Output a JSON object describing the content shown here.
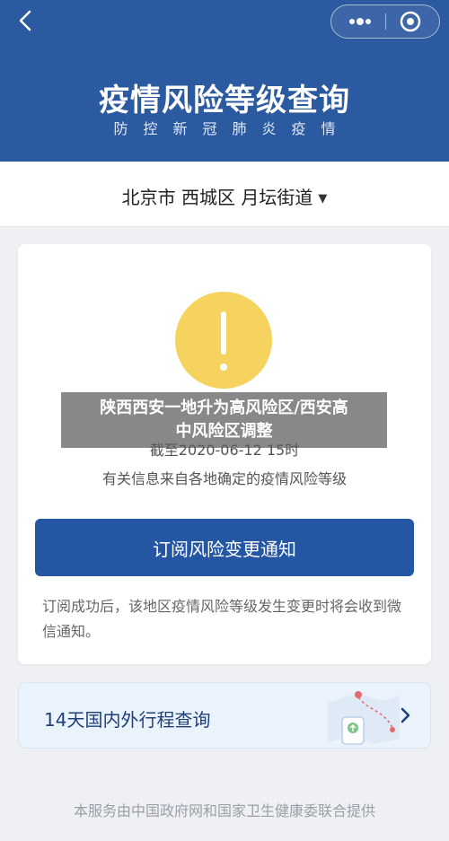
{
  "header": {
    "title": "疫情风险等级查询",
    "subtitle": "防控新冠肺炎疫情"
  },
  "location": {
    "text": "北京市 西城区 月坛街道"
  },
  "risk_card": {
    "as_of": "截至2020-06-12 15时",
    "source_note": "有关信息来自各地确定的疫情风险等级",
    "subscribe_button": "订阅风险变更通知",
    "subscribe_desc": "订阅成功后，该地区疫情风险等级发生变更时将会收到微信通知。",
    "warning_color": "#f6d35f"
  },
  "trip_query": {
    "label": "14天国内外行程查询"
  },
  "footer": {
    "text": "本服务由中国政府网和国家卫生健康委联合提供"
  },
  "overlay": {
    "line1": "陕西西安一地升为高风险区/西安高",
    "line2": "中风险区调整"
  },
  "colors": {
    "header_bg": "#2c5aa0",
    "button_bg": "#2456a4"
  }
}
